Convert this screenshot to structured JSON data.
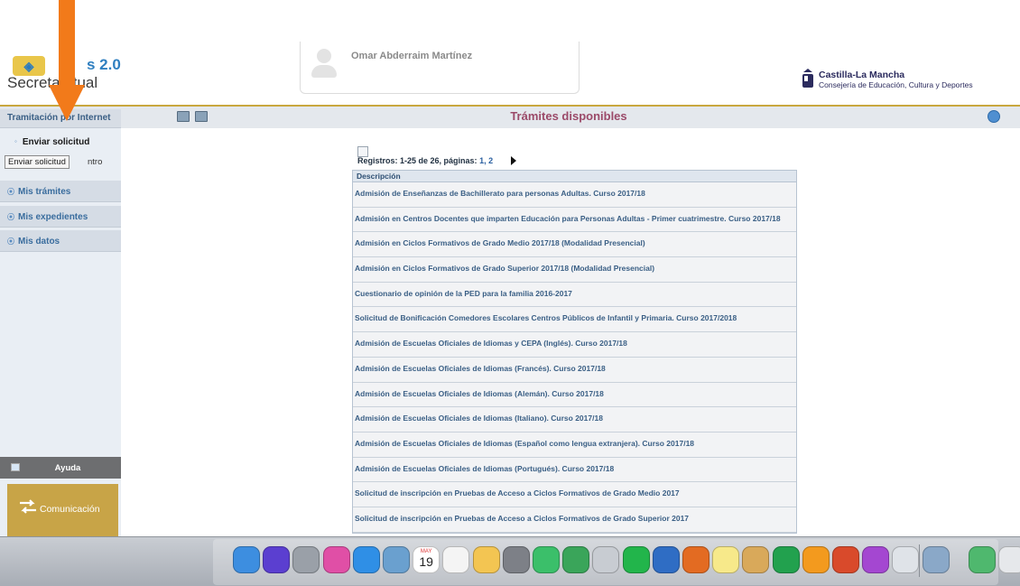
{
  "header": {
    "logo": {
      "badge": "◈",
      "top": "s 2.0",
      "bottom": "Secreta      irtual"
    },
    "user_name": "Omar Abderraim Martínez",
    "jccm": {
      "name": "Castilla-La Mancha",
      "sub": "Consejería de Educación, Cultura y Deportes"
    }
  },
  "topbar": {
    "title": "Trámites disponibles"
  },
  "sidebar": {
    "section": "Tramitación por Internet",
    "sub_active": "Enviar solicitud",
    "tooltip": "Enviar solicitud",
    "sub_tail": "ntro",
    "items": [
      {
        "label": "Mis trámites"
      },
      {
        "label": "Mis expedientes"
      },
      {
        "label": "Mis datos"
      }
    ],
    "ayuda": "Ayuda",
    "comunicacion": "Comunicación"
  },
  "pager": {
    "text": "Registros: 1-25 de 26, páginas:",
    "page1": "1,",
    "page2": "2"
  },
  "table": {
    "header": "Descripción",
    "rows": [
      "Admisión de Enseñanzas de Bachillerato para personas Adultas. Curso 2017/18",
      "Admisión en Centros Docentes que imparten Educación para Personas Adultas - Primer cuatrimestre. Curso 2017/18",
      "Admisión en Ciclos Formativos de Grado Medio 2017/18 (Modalidad Presencial)",
      "Admisión en Ciclos Formativos de Grado Superior 2017/18 (Modalidad Presencial)",
      "Cuestionario de opinión de la PED para la familia 2016-2017",
      "Solicitud de Bonificación Comedores Escolares Centros Públicos de Infantil y Primaria. Curso 2017/2018",
      "Admisión de Escuelas Oficiales de Idiomas y CEPA (Inglés). Curso 2017/18",
      "Admisión de Escuelas Oficiales de Idiomas (Francés). Curso 2017/18",
      "Admisión de Escuelas Oficiales de Idiomas (Alemán). Curso 2017/18",
      "Admisión de Escuelas Oficiales de Idiomas (Italiano). Curso 2017/18",
      "Admisión de Escuelas Oficiales de Idiomas (Español como lengua extranjera). Curso 2017/18",
      "Admisión de Escuelas Oficiales de Idiomas (Portugués). Curso 2017/18",
      "Solicitud de inscripción en Pruebas de Acceso a Ciclos Formativos de Grado Medio 2017",
      "Solicitud de inscripción en Pruebas de Acceso a Ciclos Formativos de Grado Superior 2017"
    ]
  },
  "dock": {
    "calendar_day": "19",
    "calendar_month": "MAY",
    "apps": [
      {
        "name": "finder-icon",
        "color": "#3d8ee0"
      },
      {
        "name": "siri-icon",
        "color": "#5b3fd0"
      },
      {
        "name": "launchpad-icon",
        "color": "#9aa0a8"
      },
      {
        "name": "itunes-icon",
        "color": "#e04fa6"
      },
      {
        "name": "safari-icon",
        "color": "#2f8fe6"
      },
      {
        "name": "preview-icon",
        "color": "#6aa0cf"
      },
      {
        "name": "calendar-icon",
        "color": "#ffffff"
      },
      {
        "name": "reminders-icon",
        "color": "#f4f4f4"
      },
      {
        "name": "photos-icon",
        "color": "#f3c552"
      },
      {
        "name": "system-preferences-icon",
        "color": "#7d8087"
      },
      {
        "name": "app-store-icon",
        "color": "#3bbf6a"
      },
      {
        "name": "evernote-icon",
        "color": "#3aa55a"
      },
      {
        "name": "airplane-icon",
        "color": "#c8ccd2"
      },
      {
        "name": "spotify-icon",
        "color": "#22b54b"
      },
      {
        "name": "word-icon",
        "color": "#2f6dc4"
      },
      {
        "name": "firefox-icon",
        "color": "#e36b22"
      },
      {
        "name": "notes-icon",
        "color": "#f7e98a"
      },
      {
        "name": "calculator-icon",
        "color": "#d9a95a"
      },
      {
        "name": "excel-icon",
        "color": "#22a14e"
      },
      {
        "name": "ibooks-icon",
        "color": "#f39a1e"
      },
      {
        "name": "powerpoint-icon",
        "color": "#d94a2b"
      },
      {
        "name": "imovie-icon",
        "color": "#a447d1"
      },
      {
        "name": "scrubber-icon",
        "color": "#dfe3e8"
      },
      {
        "name": "image-capture-icon",
        "color": "#8aa8c8"
      },
      {
        "name": "screenshot-icon",
        "color": "#4fb86e"
      },
      {
        "name": "trash-icon",
        "color": "#e6e8eb"
      }
    ]
  }
}
